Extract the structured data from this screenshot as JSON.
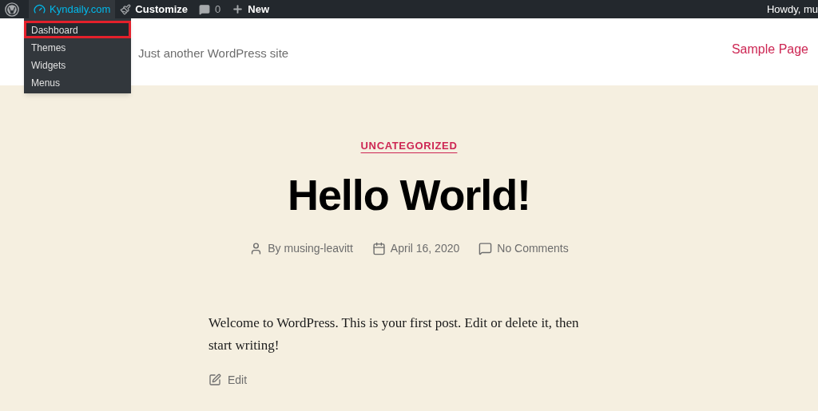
{
  "admin_bar": {
    "site_name": "Kyndaily.com",
    "customize": "Customize",
    "comments_count": "0",
    "new": "New",
    "greeting": "Howdy, mu"
  },
  "site_menu": {
    "items": [
      {
        "label": "Dashboard",
        "highlighted": true
      },
      {
        "label": "Themes",
        "highlighted": false
      },
      {
        "label": "Widgets",
        "highlighted": false
      },
      {
        "label": "Menus",
        "highlighted": false
      }
    ]
  },
  "header": {
    "tagline": "Just another WordPress site",
    "nav": [
      "Sample Page"
    ]
  },
  "post": {
    "category": "UNCATEGORIZED",
    "title": "Hello World!",
    "author": "By musing-leavitt",
    "date": "April 16, 2020",
    "comments": "No Comments",
    "body": "Welcome to WordPress. This is your first post. Edit or delete it, then start writing!",
    "edit": "Edit"
  }
}
